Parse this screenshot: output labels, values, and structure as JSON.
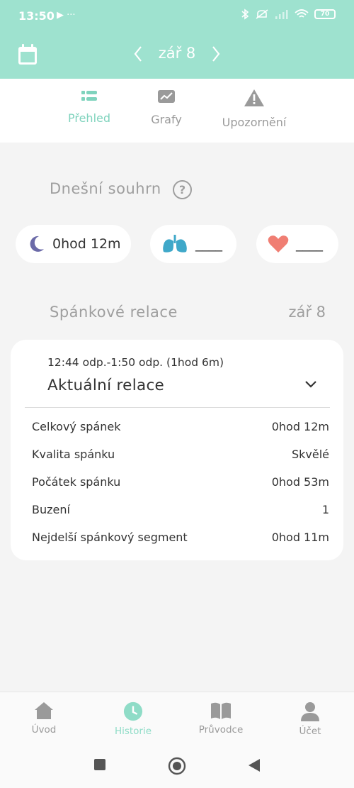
{
  "status_bar": {
    "time": "13:50",
    "left_icons": "▶ ···",
    "battery": "70"
  },
  "app_bar": {
    "date": "zář 8",
    "icons": [
      "calendar-icon",
      "chevron-left-icon",
      "chevron-right-icon"
    ]
  },
  "tabs": [
    {
      "label": "Přehled",
      "active": true
    },
    {
      "label": "Grafy",
      "active": false
    },
    {
      "label": "Upozornění",
      "active": false
    }
  ],
  "summary": {
    "title": "Dnešní souhrn",
    "help": "?",
    "sleep_value": "0hod 12m",
    "lungs_value": "____",
    "heart_value": "____"
  },
  "sessions": {
    "title": "Spánkové relace",
    "date": "zář 8",
    "card": {
      "time_range": "12:44 odp.-1:50 odp. (1hod 6m)",
      "name": "Aktuální relace",
      "rows": [
        {
          "label": "Celkový spánek",
          "value": "0hod 12m"
        },
        {
          "label": "Kvalita spánku",
          "value": "Skvělé"
        },
        {
          "label": "Počátek spánku",
          "value": "0hod 53m"
        },
        {
          "label": "Buzení",
          "value": "1"
        },
        {
          "label": "Nejdelší spánkový segment",
          "value": "0hod 11m"
        }
      ]
    }
  },
  "bottom_nav": [
    {
      "label": "Úvod",
      "active": false
    },
    {
      "label": "Historie",
      "active": true
    },
    {
      "label": "Průvodce",
      "active": false
    },
    {
      "label": "Účet",
      "active": false
    }
  ],
  "colors": {
    "accent": "#9ee2cf",
    "accent_text": "#7fd3bd",
    "moon": "#6b6aa8",
    "lungs": "#3fa8c9",
    "heart": "#f07e73"
  }
}
